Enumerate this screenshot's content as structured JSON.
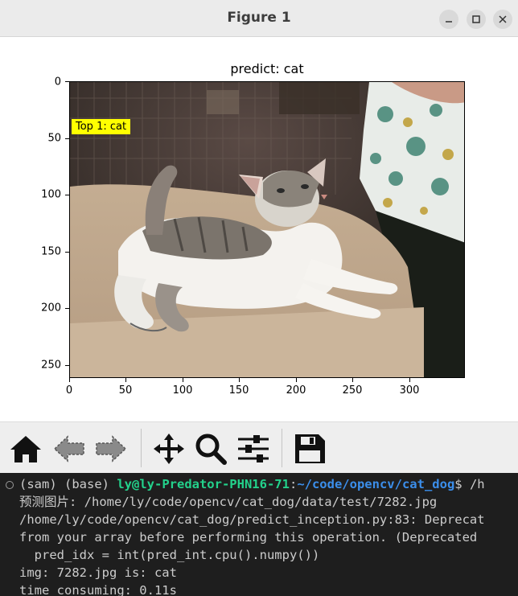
{
  "window": {
    "title": "Figure 1"
  },
  "figure": {
    "plot_title": "predict: cat",
    "overlay_label": "Top 1: cat",
    "overlay_color": "#ffff00",
    "yticks": [
      "0",
      "50",
      "100",
      "150",
      "200",
      "250"
    ],
    "xticks": [
      "0",
      "50",
      "100",
      "150",
      "200",
      "250",
      "300"
    ]
  },
  "toolbar": {
    "icons": [
      "home-icon",
      "back-arrow-icon",
      "forward-arrow-icon",
      "pan-move-icon",
      "zoom-magnifier-icon",
      "configure-subplots-icon",
      "save-floppy-icon"
    ]
  },
  "terminal": {
    "env": "(sam) (base) ",
    "user_host": "ly@ly-Predator-PHN16-71",
    "colon": ":",
    "cwd": "~/code/opencv/cat_dog",
    "prompt_tail": "$ /h",
    "lines": [
      "预测图片: /home/ly/code/opencv/cat_dog/data/test/7282.jpg",
      "/home/ly/code/opencv/cat_dog/predict_inception.py:83: Deprecat",
      "from your array before performing this operation. (Deprecated",
      "  pred_idx = int(pred_int.cpu().numpy())",
      "img: 7282.jpg is: cat",
      "time consuming: 0.11s"
    ]
  }
}
